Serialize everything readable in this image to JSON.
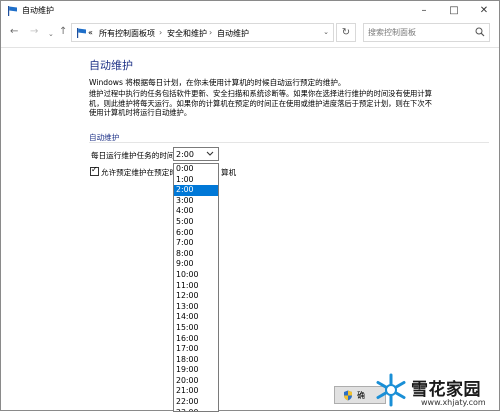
{
  "window": {
    "title": "自动维护"
  },
  "navigation": {
    "back": "←",
    "forward": "→",
    "up": "↑",
    "history_dropdown": "⌄",
    "breadcrumb": [
      "«",
      "所有控制面板项",
      "安全和维护",
      "自动维护"
    ],
    "search_placeholder": "搜索控制面板"
  },
  "page": {
    "title": "自动维护",
    "intro": "Windows 将根据每日计划，在你未使用计算机的时候自动运行预定的维护。",
    "description_lines": [
      "维护过程中执行的任务包括软件更新、安全扫描和系统诊断等。如果你在选择进行维护的时间没有使用计算",
      "机，则此维护将每天运行。如果你的计算机在预定的时间正在使用或维护进度落后于预定计划，则在下次不",
      "使用计算机时将运行自动维护。"
    ],
    "section_label": "自动维护",
    "time_label": "每日运行维护任务的时间",
    "selected_time": "2:00",
    "checkbox_label_start": "允许预定维护在预定时",
    "checkbox_label_end": "算机",
    "checkbox_checked": true
  },
  "dropdown": {
    "options": [
      "0:00",
      "1:00",
      "2:00",
      "3:00",
      "4:00",
      "5:00",
      "6:00",
      "7:00",
      "8:00",
      "9:00",
      "10:00",
      "11:00",
      "12:00",
      "13:00",
      "14:00",
      "15:00",
      "16:00",
      "17:00",
      "18:00",
      "19:00",
      "20:00",
      "21:00",
      "22:00",
      "23:00"
    ],
    "selected_index": 2
  },
  "footer": {
    "ok_label": "确"
  },
  "watermark": {
    "brand": "雪花家园",
    "url": "www.xhjaty.com"
  },
  "colors": {
    "accent": "#0078d7",
    "heading": "#1e3287",
    "watermark_logo": "#1a8fd6"
  }
}
